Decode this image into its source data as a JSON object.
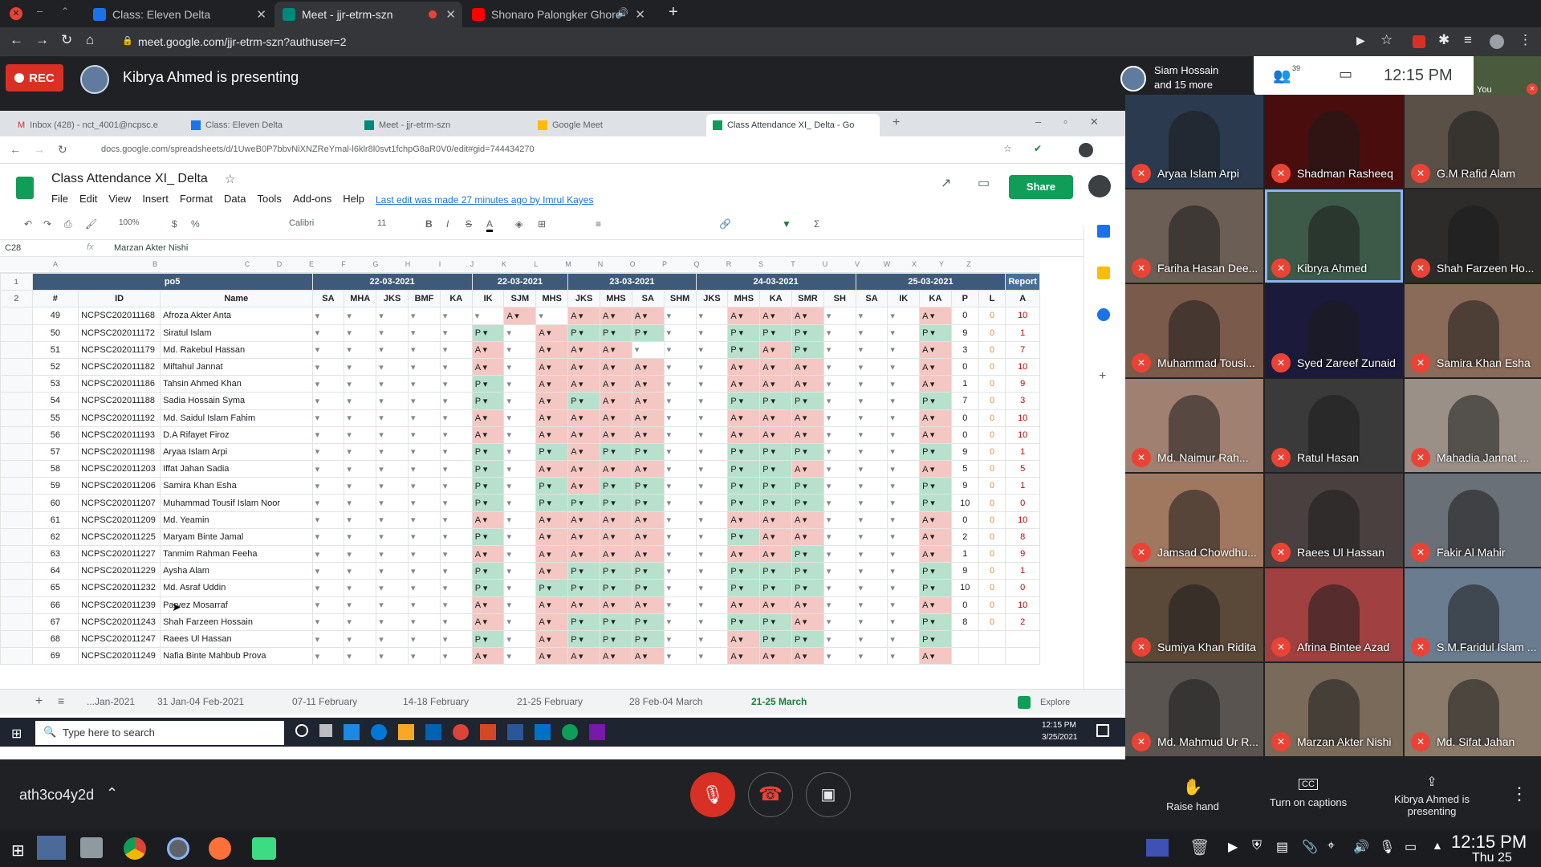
{
  "browser": {
    "tabs": [
      {
        "title": "Class: Eleven Delta",
        "color": "#1a73e8"
      },
      {
        "title": "Meet - jjr-etrm-szn",
        "color": "#00897b"
      },
      {
        "title": "Shonaro Palongker Ghore",
        "color": "#ff0000"
      }
    ],
    "url": "meet.google.com/jjr-etrm-szn?authuser=2"
  },
  "meet": {
    "rec_label": "REC",
    "presenting": "Kibrya Ahmed is presenting",
    "participants_name": "Siam Hossain",
    "participants_more": "and 15 more",
    "participant_count": "39",
    "time": "12:15 PM",
    "self_label": "You",
    "meeting_code": "ath3co4y2d",
    "raise_hand": "Raise hand",
    "captions": "Turn on captions",
    "presenting_ctl": "Kibrya Ahmed is presenting"
  },
  "tiles": [
    "Aryaa Islam Arpi",
    "Shadman Rasheeq",
    "G.M Rafid Alam",
    "Fariha Hasan Dee...",
    "Kibrya Ahmed",
    "Shah Farzeen Ho...",
    "Muhammad Tousi...",
    "Syed Zareef Zunaid",
    "Samira Khan Esha",
    "Md. Naimur Rah...",
    "Ratul Hasan",
    "Mahadia Jannat ...",
    "Jamsad Chowdhu...",
    "Raees Ul Hassan",
    "Fakir Al Mahir",
    "Sumiya Khan Ridita",
    "Afrina Bintee Azad",
    "S.M.Faridul Islam ...",
    "Md. Mahmud Ur R...",
    "Marzan Akter Nishi",
    "Md. Sifat Jahan"
  ],
  "inner": {
    "tabs": [
      "Inbox (428) - nct_4001@ncpsc.e",
      "Class: Eleven Delta",
      "Meet - jjr-etrm-szn",
      "Google Meet",
      "Class Attendance XI_ Delta - Go"
    ],
    "url": "docs.google.com/spreadsheets/d/1UweB0P7bbvNiXNZReYmal-l6klr8l0svt1fchpG8aR0V0/edit#gid=744434270",
    "doc_title": "Class Attendance XI_ Delta",
    "menus": [
      "File",
      "Edit",
      "View",
      "Insert",
      "Format",
      "Data",
      "Tools",
      "Add-ons",
      "Help"
    ],
    "last_edit": "Last edit was made 27 minutes ago by Imrul Kayes",
    "share": "Share",
    "zoom": "100%",
    "font": "Calibri",
    "font_size": "11",
    "cell_ref": "C28",
    "cell_value": "Marzan Akter Nishi",
    "section": "po5",
    "dates": [
      "22-03-2021",
      "22-03-2021",
      "23-03-2021",
      "24-03-2021",
      "25-03-2021"
    ],
    "report": "Report",
    "col_hash": "#",
    "col_id": "ID",
    "col_name": "Name",
    "subjects": [
      "SA",
      "MHA",
      "JKS",
      "BMF",
      "KA",
      "IK",
      "SJM",
      "MHS",
      "JKS",
      "MHS",
      "SA",
      "SHM",
      "JKS",
      "MHS",
      "KA",
      "SMR",
      "SH",
      "SA",
      "IK",
      "KA"
    ],
    "report_cols": [
      "P",
      "L",
      "A"
    ],
    "col_letters": [
      "A",
      "B",
      "C",
      "D",
      "E",
      "F",
      "G",
      "H",
      "I",
      "J",
      "K",
      "L",
      "M",
      "N",
      "O",
      "P",
      "Q",
      "R",
      "S",
      "T",
      "U",
      "V",
      "W",
      "X",
      "Y",
      "Z"
    ],
    "explore": "Explore"
  },
  "rows": [
    {
      "n": "49",
      "id": "NCPSC202011168",
      "name": "Afroza Akter Anta",
      "cells": "------A-AAA--AAA---AA-",
      "p": "0",
      "l": "0",
      "a": "10"
    },
    {
      "n": "50",
      "id": "NCPSC202011172",
      "name": "Siratul Islam",
      "cells": "-----P-APPP--PPP---PP-",
      "p": "9",
      "l": "0",
      "a": "1"
    },
    {
      "n": "51",
      "id": "NCPSC202011179",
      "name": "Md. Rakebul Hassan",
      "cells": "-----A-AAA---PAP---AA-",
      "p": "3",
      "l": "0",
      "a": "7"
    },
    {
      "n": "52",
      "id": "NCPSC202011182",
      "name": "Miftahul Jannat",
      "cells": "-----A-AAAA--AAA---AA-",
      "p": "0",
      "l": "0",
      "a": "10"
    },
    {
      "n": "53",
      "id": "NCPSC202011186",
      "name": "Tahsin Ahmed Khan",
      "cells": "-----P-AAAA--AAA---AA-",
      "p": "1",
      "l": "0",
      "a": "9"
    },
    {
      "n": "54",
      "id": "NCPSC202011188",
      "name": "Sadia Hossain Syma",
      "cells": "-----P-APAA--PPP---PP-",
      "p": "7",
      "l": "0",
      "a": "3"
    },
    {
      "n": "55",
      "id": "NCPSC202011192",
      "name": "Md. Saidul Islam Fahim",
      "cells": "-----A-AAAA--AAA---AA-",
      "p": "0",
      "l": "0",
      "a": "10"
    },
    {
      "n": "56",
      "id": "NCPSC202011193",
      "name": "D.A Rifayet Firoz",
      "cells": "-----A-AAAA--AAA---AA-",
      "p": "0",
      "l": "0",
      "a": "10"
    },
    {
      "n": "57",
      "id": "NCPSC202011198",
      "name": "Aryaa Islam Arpi",
      "cells": "-----P-PAPP--PPP---PP-",
      "p": "9",
      "l": "0",
      "a": "1"
    },
    {
      "n": "58",
      "id": "NCPSC202011203",
      "name": "Iffat Jahan Sadia",
      "cells": "-----P-AAAA--PPA---AA-",
      "p": "5",
      "l": "0",
      "a": "5"
    },
    {
      "n": "59",
      "id": "NCPSC202011206",
      "name": "Samira Khan Esha",
      "cells": "-----P-PAPP--PPP---PP-",
      "p": "9",
      "l": "0",
      "a": "1"
    },
    {
      "n": "60",
      "id": "NCPSC202011207",
      "name": "Muhammad Tousif Islam Noor",
      "cells": "-----P-PPPP--PPP---PP-",
      "p": "10",
      "l": "0",
      "a": "0"
    },
    {
      "n": "61",
      "id": "NCPSC202011209",
      "name": "Md. Yeamin",
      "cells": "-----A-AAAA--AAA---AA-",
      "p": "0",
      "l": "0",
      "a": "10"
    },
    {
      "n": "62",
      "id": "NCPSC202011225",
      "name": "Maryam Binte Jamal",
      "cells": "-----P-AAAA--PAA---AA-",
      "p": "2",
      "l": "0",
      "a": "8"
    },
    {
      "n": "63",
      "id": "NCPSC202011227",
      "name": "Tanmim Rahman Feeha",
      "cells": "-----A-AAAA--AAP---AA-",
      "p": "1",
      "l": "0",
      "a": "9"
    },
    {
      "n": "64",
      "id": "NCPSC202011229",
      "name": "Aysha Alam",
      "cells": "-----P-APPP--PPP---PP-",
      "p": "9",
      "l": "0",
      "a": "1"
    },
    {
      "n": "65",
      "id": "NCPSC202011232",
      "name": "Md. Asraf Uddin",
      "cells": "-----P-PPPP--PPP---PP-",
      "p": "10",
      "l": "0",
      "a": "0"
    },
    {
      "n": "66",
      "id": "NCPSC202011239",
      "name": "Parvez Mosarraf",
      "cells": "-----A-AAAA--AAA---AA-",
      "p": "0",
      "l": "0",
      "a": "10"
    },
    {
      "n": "67",
      "id": "NCPSC202011243",
      "name": "Shah Farzeen Hossain",
      "cells": "-----A-APPP--PPA---PP-",
      "p": "8",
      "l": "0",
      "a": "2"
    },
    {
      "n": "68",
      "id": "NCPSC202011247",
      "name": "Raees Ul Hassan",
      "cells": "-----P-APPP--APP---PP-",
      "p": "",
      "l": "",
      "a": ""
    },
    {
      "n": "69",
      "id": "NCPSC202011249",
      "name": "Nafia Binte Mahbub Prova",
      "cells": "-----A-AAAA--AAA---AA-",
      "p": "",
      "l": "",
      "a": ""
    }
  ],
  "sheet_tabs": [
    "...Jan-2021",
    "31 Jan-04 Feb-2021",
    "07-11 February",
    "14-18 February",
    "21-25 February",
    "28 Feb-04 March",
    "21-25 March"
  ],
  "win": {
    "search": "Type here to search",
    "time": "12:15 PM",
    "date": "3/25/2021"
  },
  "os": {
    "time": "12:15 PM",
    "date": "Thu 25"
  }
}
